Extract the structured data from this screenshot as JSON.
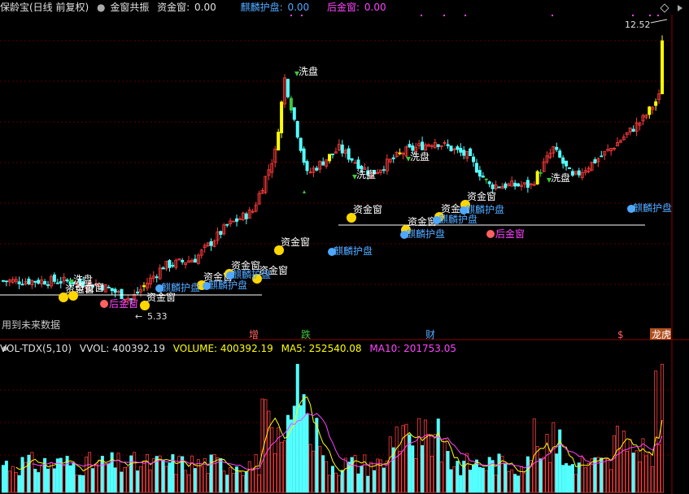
{
  "header": {
    "stock_name": "保龄宝(日线 前复权)",
    "indicator_toggle": "●",
    "indicator_name": "金窗共振",
    "jinchuang_label": "资金窗:",
    "jinchuang_value": "0.00",
    "qilin_label": "麒麟护盘:",
    "qilin_value": "0.00",
    "houjin_label": "后金窗:",
    "houjin_value": "0.00"
  },
  "price_panel": {
    "high_label": "12.52",
    "low_label": "5.33",
    "future_data_label": "用到未来数据",
    "events": [
      "增",
      "跌",
      "财",
      "$",
      "龙虎"
    ]
  },
  "volume_panel": {
    "indicator_name": "VOL-TDX(5,10)",
    "vvol_label": "VVOL: 400392.19",
    "volume_label": "VOLUME: 400392.19",
    "ma5_label": "MA5: 252540.08",
    "ma10_label": "MA10: 201753.05"
  },
  "signals": {
    "xipan": "洗盘",
    "zijinchuang": "资金窗",
    "qilinhupan": "麒麟护盘",
    "houjinchuang": "后金窗"
  },
  "colors": {
    "background": "#000000",
    "up": "#ff3c3c",
    "down": "#54ffff",
    "ma5": "#ffff00",
    "ma10": "#ff44ff",
    "green_bar": "#3fc43f",
    "yellow_bar": "#ffff00",
    "grid": "#8b0000"
  },
  "chart_data": [
    {
      "type": "candlestick",
      "title": "保龄宝(日线 前复权)",
      "price_max": 12.52,
      "price_min": 5.33,
      "support_lines": [],
      "bars": 160
    },
    {
      "type": "bar",
      "title": "VOL-TDX(5,10)",
      "series": [
        {
          "name": "VOLUME",
          "last": 400392.19
        },
        {
          "name": "MA5",
          "last": 252540.08
        },
        {
          "name": "MA10",
          "last": 201753.05
        }
      ]
    }
  ]
}
